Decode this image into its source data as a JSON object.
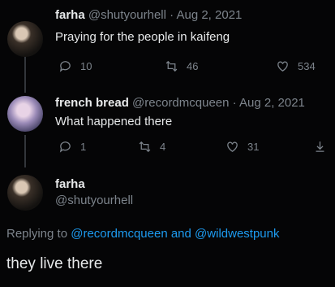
{
  "tweet1": {
    "name": "farha",
    "handle": "@shutyourhell",
    "date": "Aug 2, 2021",
    "text": "Praying for the people in kaifeng",
    "replies": "10",
    "retweets": "46",
    "likes": "534"
  },
  "tweet2": {
    "name": "french bread",
    "handle": "@recordmcqueen",
    "date": "Aug 2, 2021",
    "text": "What happened there",
    "replies": "1",
    "retweets": "4",
    "likes": "31"
  },
  "tweet3": {
    "name": "farha",
    "handle": "@shutyourhell",
    "replying_prefix": "Replying to",
    "reply_user1": "@recordmcqueen",
    "reply_and": "and",
    "reply_user2": "@wildwestpunk",
    "text": "they live there"
  },
  "icons": [
    "reply-icon",
    "retweet-icon",
    "like-icon",
    "share-icon"
  ]
}
